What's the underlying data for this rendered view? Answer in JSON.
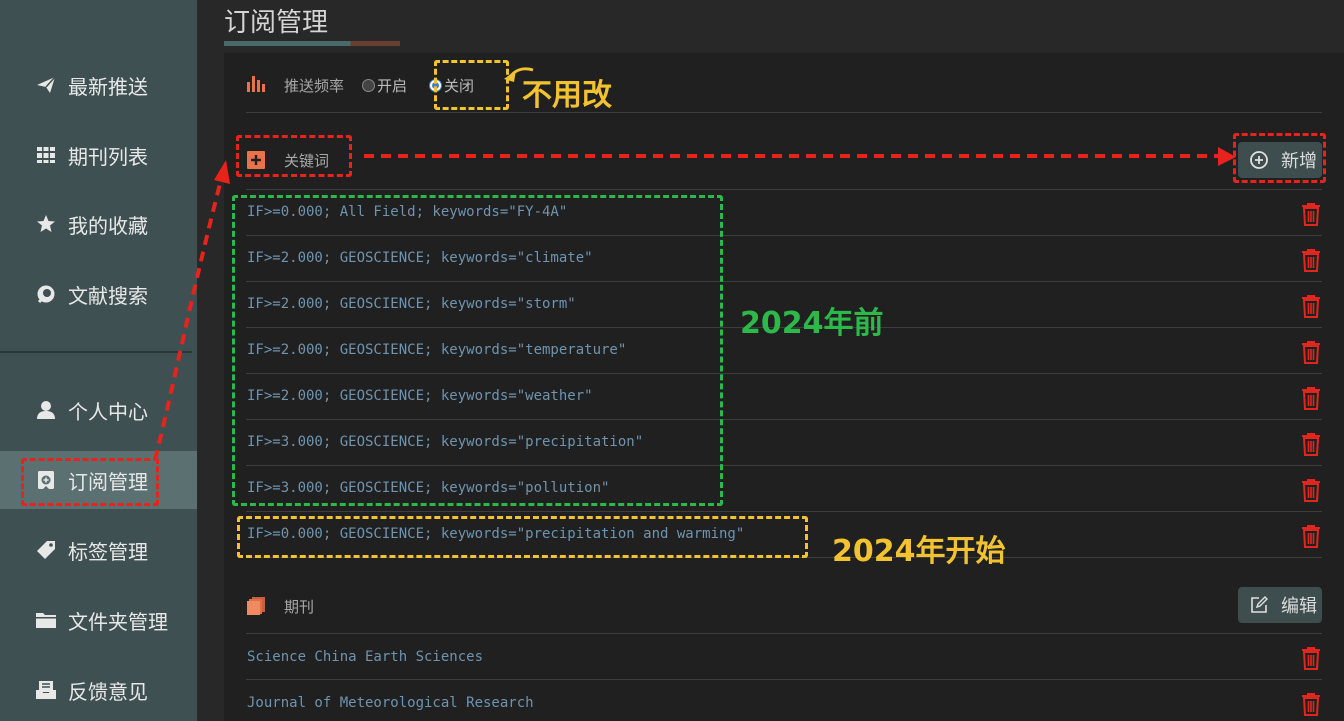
{
  "sidebar": {
    "items": [
      {
        "label": "最新推送",
        "icon": "paper-plane-icon"
      },
      {
        "label": "期刊列表",
        "icon": "books-icon"
      },
      {
        "label": "我的收藏",
        "icon": "star-badge-icon"
      },
      {
        "label": "文献搜索",
        "icon": "search-bubble-icon"
      },
      {
        "label": "个人中心",
        "icon": "user-icon"
      },
      {
        "label": "订阅管理",
        "icon": "subscription-icon",
        "active": true
      },
      {
        "label": "标签管理",
        "icon": "tag-icon"
      },
      {
        "label": "文件夹管理",
        "icon": "folder-icon"
      },
      {
        "label": "反馈意见",
        "icon": "inbox-icon"
      }
    ]
  },
  "header": {
    "title": "订阅管理"
  },
  "frequency": {
    "label": "推送频率",
    "options": [
      {
        "label": "开启",
        "selected": false
      },
      {
        "label": "关闭",
        "selected": true
      }
    ],
    "icon": "bar-chart-icon"
  },
  "keywords": {
    "title": "关键词",
    "icon": "add-square-icon",
    "add_button": "新增",
    "items": [
      "IF>=0.000; All Field; keywords=\"FY-4A\"",
      "IF>=2.000; GEOSCIENCE; keywords=\"climate\"",
      "IF>=2.000; GEOSCIENCE; keywords=\"storm\"",
      "IF>=2.000; GEOSCIENCE; keywords=\"temperature\"",
      "IF>=2.000; GEOSCIENCE; keywords=\"weather\"",
      "IF>=3.000; GEOSCIENCE; keywords=\"precipitation\"",
      "IF>=3.000; GEOSCIENCE; keywords=\"pollution\"",
      "IF>=0.000; GEOSCIENCE; keywords=\"precipitation and warming\""
    ]
  },
  "journals": {
    "title": "期刊",
    "icon": "journals-icon",
    "edit_button": "编辑",
    "items": [
      "Science China Earth Sciences",
      "Journal of Meteorological Research"
    ]
  },
  "annotations": {
    "no_change": "不用改",
    "before_2024": "2024年前",
    "from_2024": "2024年开始"
  },
  "colors": {
    "sidebar_bg": "#3f5052",
    "sidebar_active": "#5a7071",
    "panel_bg": "#202020",
    "keyword_text": "#6e94b0",
    "trash_red": "#e0271f",
    "annotation_red": "#e8231b",
    "annotation_green": "#2db84a",
    "annotation_yellow": "#f2c230"
  }
}
